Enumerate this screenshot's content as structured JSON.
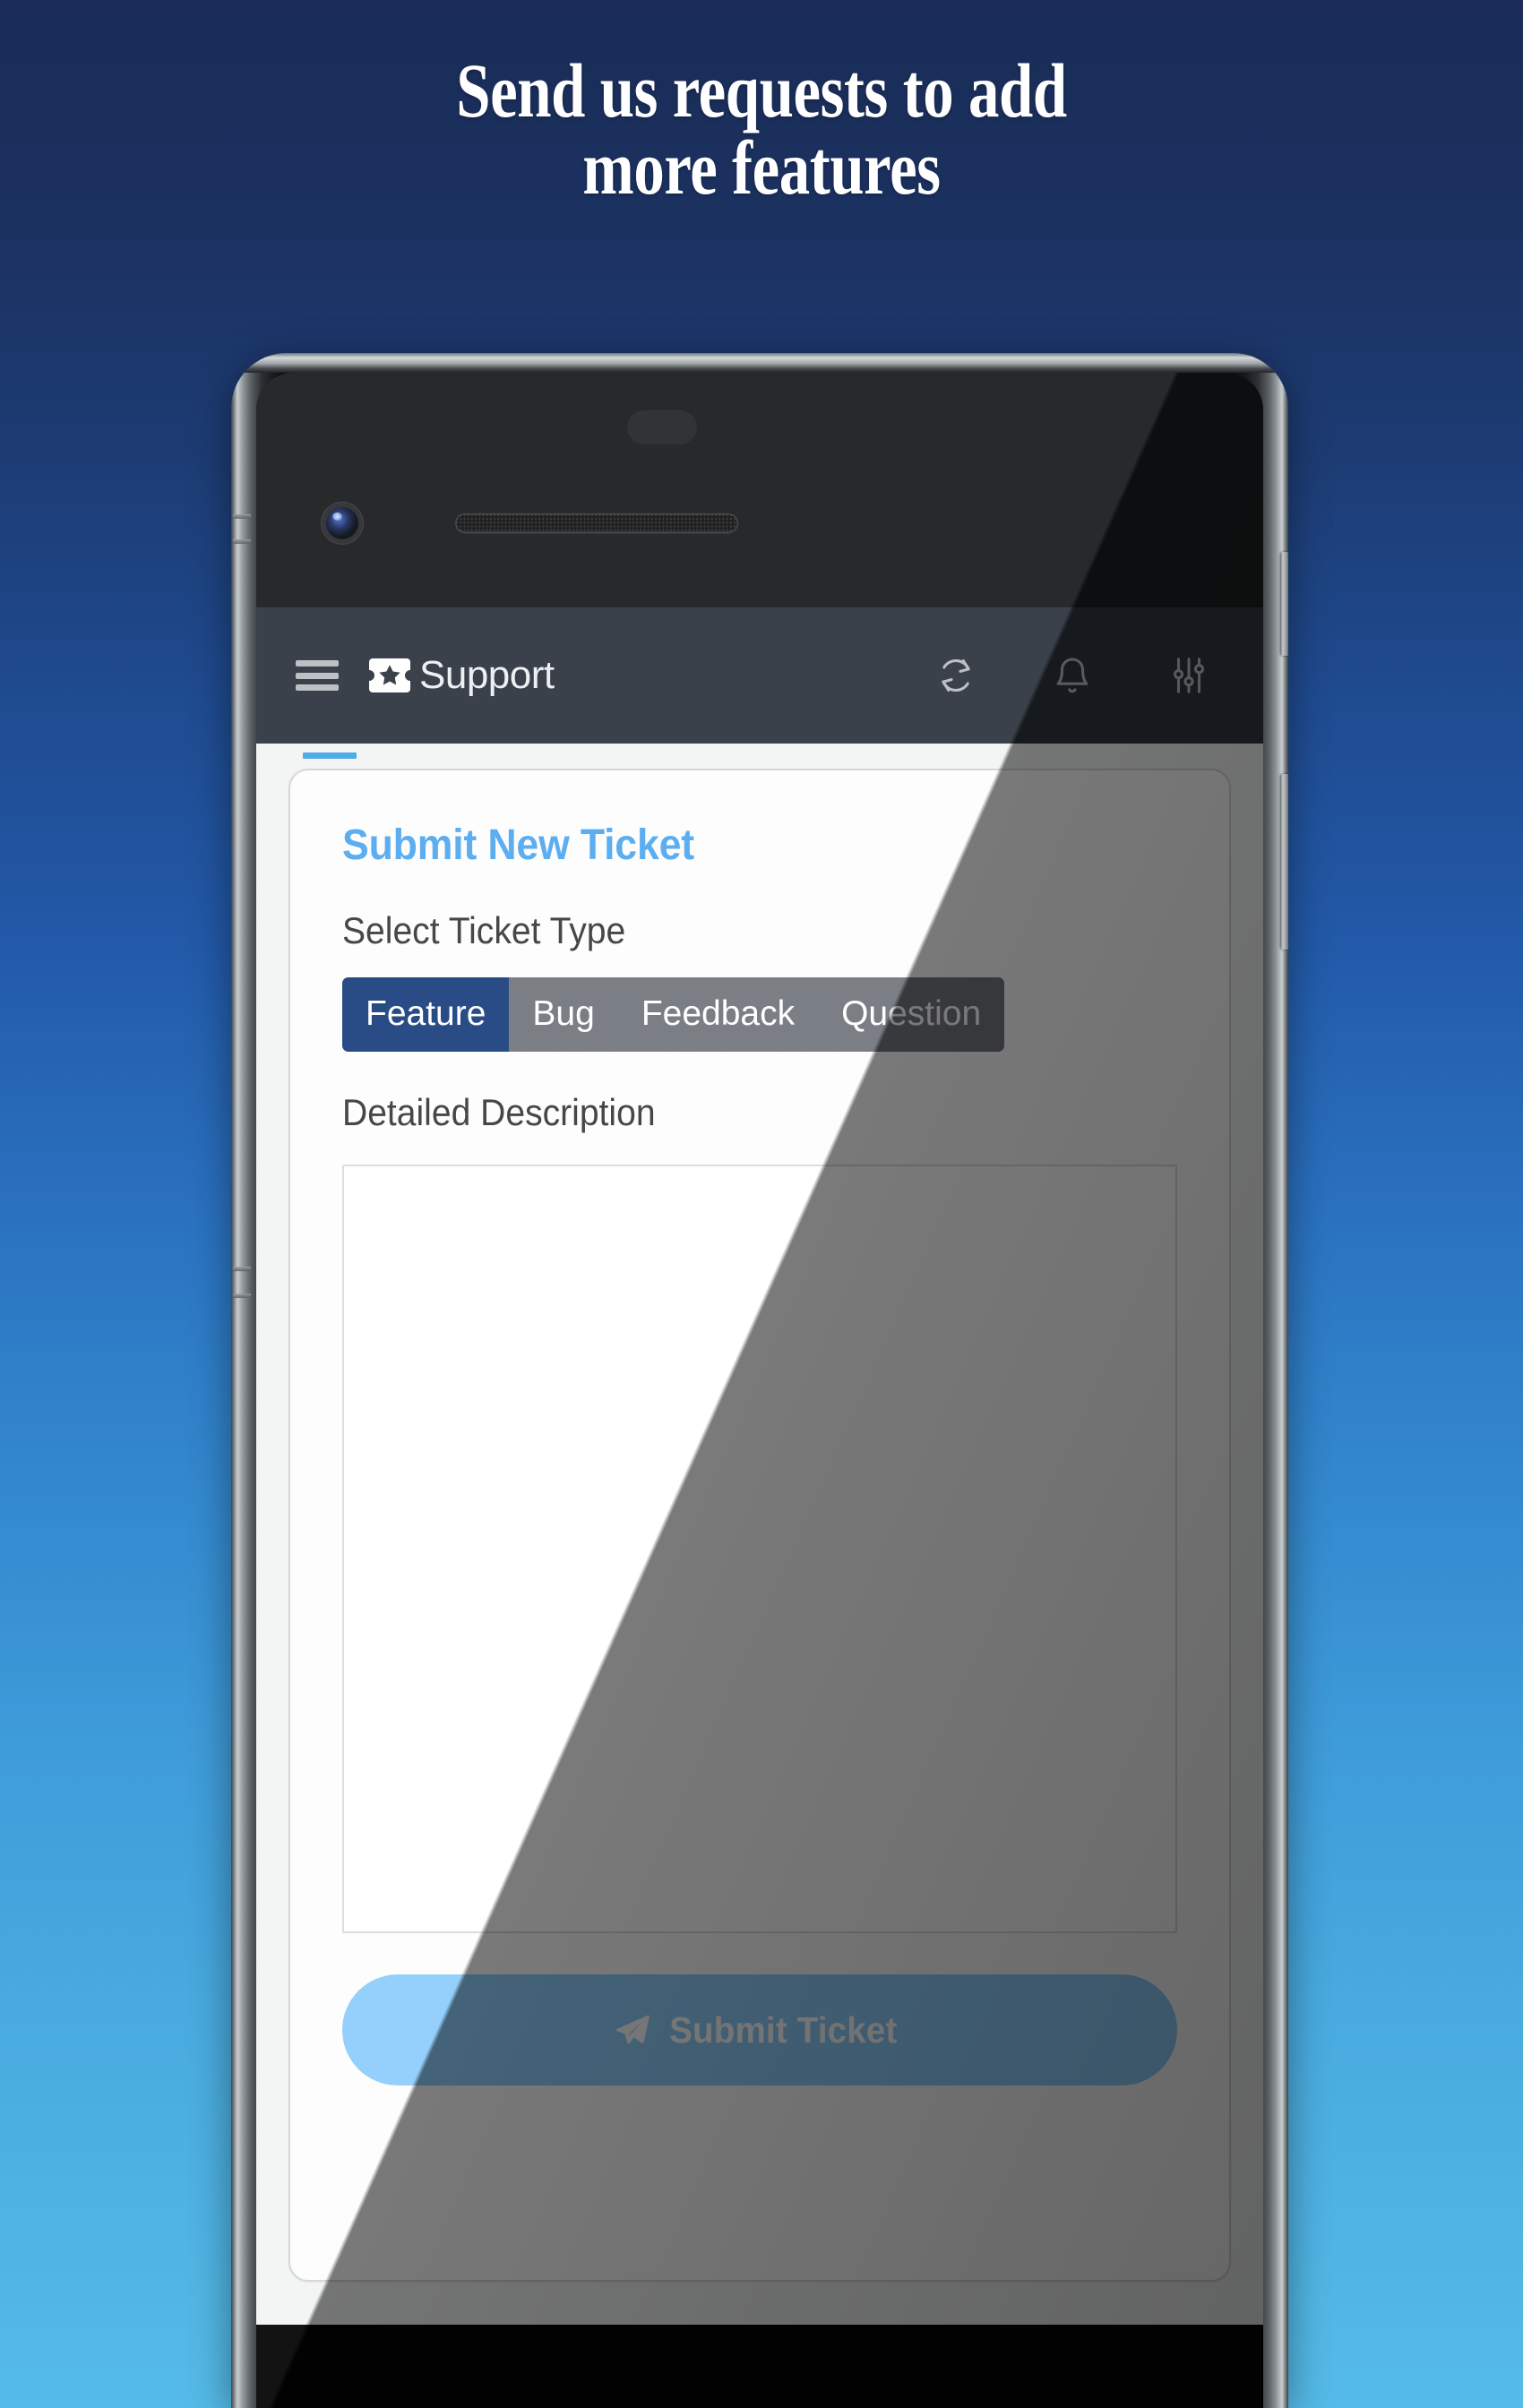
{
  "promo": {
    "headline": "Send us requests to add\nmore features"
  },
  "appbar": {
    "menu_icon": "hamburger-menu-icon",
    "logo_icon": "ticket-star-icon",
    "title": "Support",
    "actions": [
      {
        "name": "refresh-icon",
        "label": "Refresh"
      },
      {
        "name": "bell-icon",
        "label": "Notifications"
      },
      {
        "name": "sliders-icon",
        "label": "Filters"
      }
    ]
  },
  "form": {
    "card_title": "Submit New Ticket",
    "ticket_type_label": "Select Ticket Type",
    "ticket_types": [
      "Feature",
      "Bug",
      "Feedback",
      "Question"
    ],
    "selected_ticket_type": "Feature",
    "description_label": "Detailed Description",
    "description_value": "",
    "description_placeholder": "",
    "submit_label": "Submit Ticket",
    "submit_icon": "paper-plane-icon"
  },
  "colors": {
    "bg_top": "#1a2c57",
    "bg_bottom": "#55bbe8",
    "appbar": "#2f3640",
    "accent_blue": "#54a9f0",
    "tab_indicator": "#45a7e8",
    "segment_active": "#1d4280",
    "segment_inactive": "#73787e",
    "submit_button": "#8ecdfb",
    "card_bg": "#fdfdfd",
    "page_bg": "#f2f4f4"
  }
}
